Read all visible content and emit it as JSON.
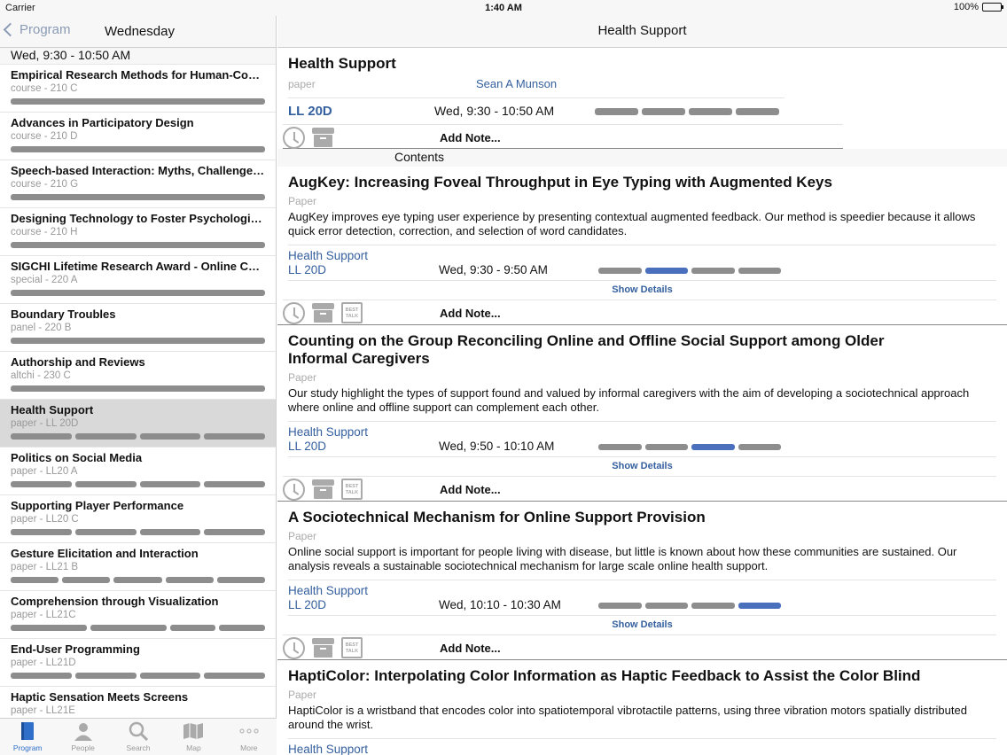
{
  "status": {
    "carrier": "Carrier",
    "time": "1:40 AM",
    "battery": "100%"
  },
  "left": {
    "back_label": "Program",
    "title": "Wednesday",
    "section": "Wed, 9:30 - 10:50 AM",
    "sessions": [
      {
        "title": "Empirical Research Methods for Human-Comp...",
        "sub": "course - 210 C",
        "bars": [
          "g"
        ]
      },
      {
        "title": "Advances in Participatory Design",
        "sub": "course - 210 D",
        "bars": [
          "g"
        ]
      },
      {
        "title": "Speech-based Interaction: Myths, Challenges,...",
        "sub": "course - 210 G",
        "bars": [
          "g"
        ]
      },
      {
        "title": "Designing Technology to Foster Psychological...",
        "sub": "course - 210 H",
        "bars": [
          "g"
        ]
      },
      {
        "title": "SIGCHI Lifetime Research Award - Online Com...",
        "sub": "special - 220 A",
        "bars": [
          "g"
        ]
      },
      {
        "title": "Boundary Troubles",
        "sub": "panel - 220 B",
        "bars": [
          "g"
        ]
      },
      {
        "title": "Authorship and Reviews",
        "sub": "altchi - 230 C",
        "bars": [
          "g"
        ]
      },
      {
        "title": "Health Support",
        "sub": "paper - LL 20D",
        "bars": [
          "g",
          "g",
          "g",
          "g"
        ],
        "selected": true
      },
      {
        "title": "Politics on Social Media",
        "sub": "paper - LL20 A",
        "bars": [
          "g",
          "g",
          "g",
          "g"
        ]
      },
      {
        "title": "Supporting Player Performance",
        "sub": "paper - LL20 C",
        "bars": [
          "g",
          "g",
          "g",
          "g"
        ]
      },
      {
        "title": "Gesture Elicitation and Interaction",
        "sub": "paper - LL21 B",
        "bars": [
          "g",
          "g",
          "g",
          "g",
          "g"
        ]
      },
      {
        "title": "Comprehension through Visualization",
        "sub": "paper - LL21C",
        "bars": [
          "g",
          "g",
          "n",
          "n"
        ]
      },
      {
        "title": "End-User Programming",
        "sub": "paper - LL21D",
        "bars": [
          "g",
          "g",
          "g",
          "g"
        ]
      },
      {
        "title": "Haptic Sensation Meets Screens",
        "sub": "paper - LL21E",
        "bars": []
      }
    ],
    "tabs": [
      {
        "label": "Program",
        "icon": "book-icon",
        "active": true
      },
      {
        "label": "People",
        "icon": "person-icon"
      },
      {
        "label": "Search",
        "icon": "search-icon"
      },
      {
        "label": "Map",
        "icon": "map-icon"
      },
      {
        "label": "More",
        "icon": "more-icon"
      }
    ]
  },
  "right": {
    "nav_title": "Health Support",
    "header": {
      "title": "Health Support",
      "type": "paper",
      "author": "Sean A Munson",
      "room": "LL 20D",
      "time": "Wed, 9:30 - 10:50 AM",
      "add_note": "Add Note..."
    },
    "contents_label": "Contents",
    "papers": [
      {
        "title": "AugKey: Increasing Foveal Throughput in Eye Typing with Augmented Keys",
        "type": "Paper",
        "abstract": "AugKey improves eye typing user experience by presenting contextual augmented feedback. Our method is speedier because it allows quick error detection, correction, and selection of word candidates.",
        "session": "Health Support",
        "room": "LL 20D",
        "time": "Wed, 9:30 - 9:50 AM",
        "active_slot": 2,
        "details": "Show Details",
        "add_note": "Add Note..."
      },
      {
        "title": "Counting on the Group  Reconciling Online and Offline Social Support  among Older Informal Caregivers",
        "type": "Paper",
        "abstract": "Our study highlight the types of support found and valued by informal caregivers with the aim of developing a sociotechnical approach where online and offline support can complement each other.",
        "session": "Health Support",
        "room": "LL 20D",
        "time": "Wed, 9:50 - 10:10 AM",
        "active_slot": 3,
        "details": "Show Details",
        "add_note": "Add Note..."
      },
      {
        "title": "A Sociotechnical Mechanism for Online Support Provision",
        "type": "Paper",
        "abstract": "Online social support is important for people living with disease, but little is known about how these communities are sustained. Our analysis reveals a sustainable sociotechnical mechanism for large scale online health support.",
        "session": "Health Support",
        "room": "LL 20D",
        "time": "Wed, 10:10 - 10:30 AM",
        "active_slot": 4,
        "details": "Show Details",
        "add_note": "Add Note..."
      },
      {
        "title": "HaptiColor: Interpolating Color Information as Haptic Feedback to Assist the Color Blind",
        "type": "Paper",
        "abstract": "HaptiColor is a wristband that encodes color into spatiotemporal vibrotactile patterns, using three vibration motors spatially distributed around the wrist.",
        "session": "Health Support"
      }
    ],
    "best_talk_icon_text": "BEST TALK"
  },
  "colors": {
    "accent": "#35609f",
    "bar_gray": "#8d8d8d",
    "bar_active": "#4a6fbd",
    "selected_row": "#d9d9d9"
  }
}
